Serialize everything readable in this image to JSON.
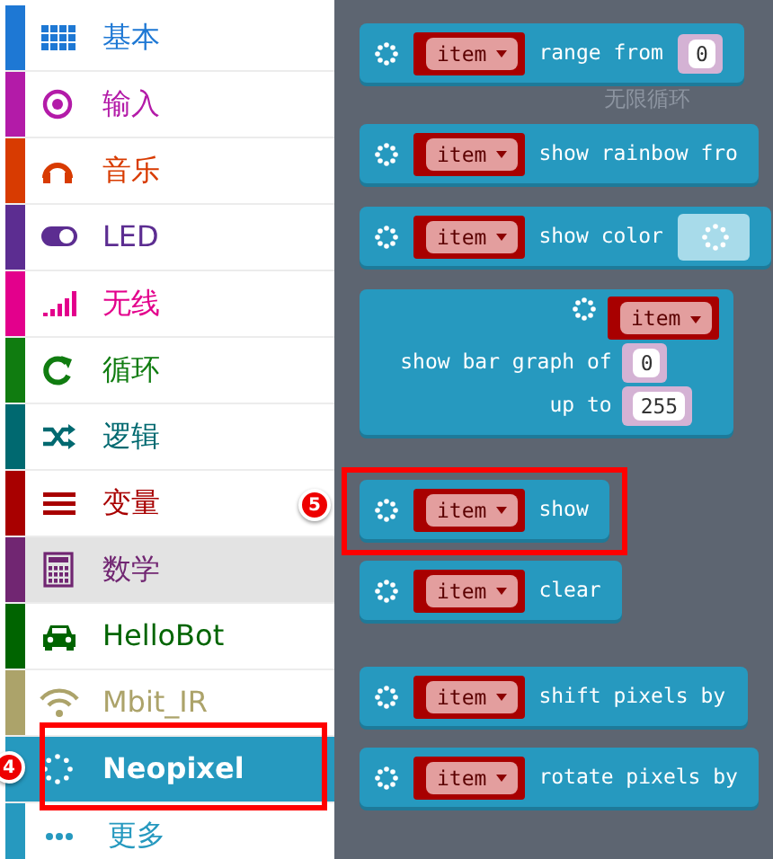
{
  "categories": [
    {
      "label": "基本",
      "color": "#1e78d4",
      "selected": false,
      "hovered": false
    },
    {
      "label": "输入",
      "color": "#b31ba8",
      "selected": false,
      "hovered": false
    },
    {
      "label": "音乐",
      "color": "#d83b01",
      "selected": false,
      "hovered": false
    },
    {
      "label": "LED",
      "color": "#5c2d91",
      "selected": false,
      "hovered": false
    },
    {
      "label": "无线",
      "color": "#e3008c",
      "selected": false,
      "hovered": false
    },
    {
      "label": "循环",
      "color": "#107c10",
      "selected": false,
      "hovered": false
    },
    {
      "label": "逻辑",
      "color": "#006970",
      "selected": false,
      "hovered": false
    },
    {
      "label": "变量",
      "color": "#a80000",
      "selected": false,
      "hovered": false
    },
    {
      "label": "数学",
      "color": "#712672",
      "selected": false,
      "hovered": true
    },
    {
      "label": "HelloBot",
      "color": "#006400",
      "selected": false,
      "hovered": false
    },
    {
      "label": "Mbit_IR",
      "color": "#aca36a",
      "selected": false,
      "hovered": false
    },
    {
      "label": "Neopixel",
      "color": "#2699bf",
      "selected": true,
      "hovered": false,
      "callout": "4"
    },
    {
      "label": "更多",
      "color": "#2699bf",
      "selected": false,
      "hovered": false
    }
  ],
  "flyout": {
    "background_text": "无限循环",
    "blocks": [
      {
        "kind": "plain",
        "variable": "item",
        "label": "range from",
        "input": {
          "kind": "number",
          "value": "0"
        }
      },
      {
        "kind": "plain",
        "variable": "item",
        "label": "show rainbow fro"
      },
      {
        "kind": "plain",
        "variable": "item",
        "label": "show color",
        "input": {
          "kind": "color"
        }
      },
      {
        "kind": "bargraph",
        "variable": "item",
        "label": "show bar graph of",
        "input": {
          "kind": "number",
          "value": "0"
        },
        "label_2": "up to",
        "input_2": {
          "kind": "number",
          "value": "255"
        }
      },
      {
        "kind": "plain",
        "variable": "item",
        "label": "show",
        "callout": "5"
      },
      {
        "kind": "plain",
        "variable": "item",
        "label": "clear"
      },
      {
        "kind": "plain",
        "variable": "item",
        "label": "shift pixels by"
      },
      {
        "kind": "plain",
        "variable": "item",
        "label": "rotate pixels by"
      }
    ]
  }
}
